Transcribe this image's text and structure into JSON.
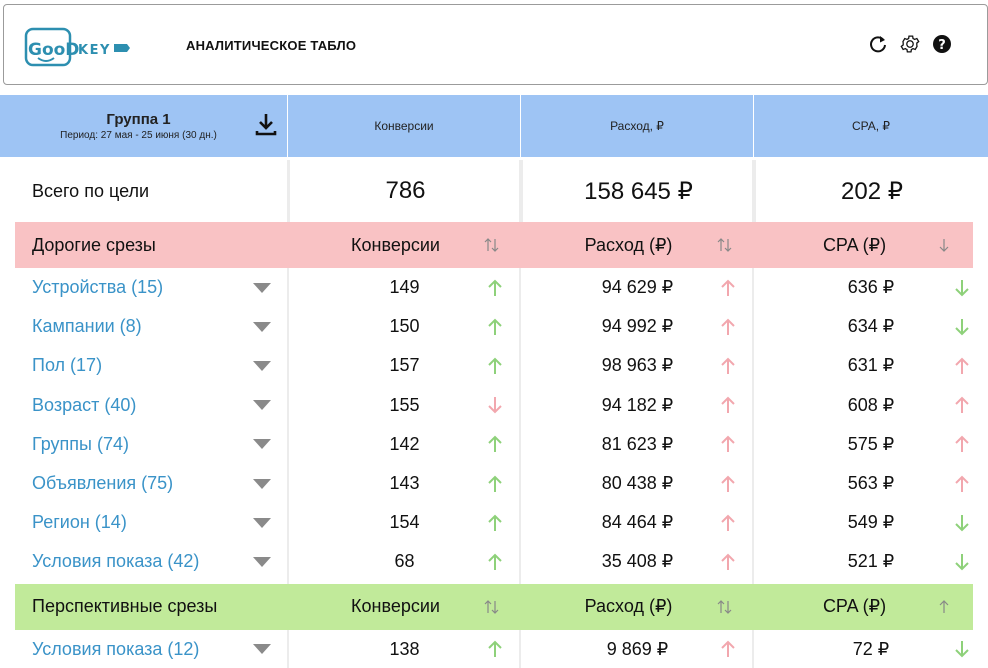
{
  "app": {
    "title": "АНАЛИТИЧЕСКОЕ ТАБЛО",
    "logo_text": "GooD KEY"
  },
  "icons": {
    "refresh": "refresh-icon",
    "settings": "gear-icon",
    "help": "help-icon",
    "download": "download-icon"
  },
  "header": {
    "group_name": "Группа 1",
    "group_period": "Период: 27 мая - 25 июня (30 дн.)",
    "col1": "Конверсии",
    "col2": "Расход, ₽",
    "col3": "CPA, ₽"
  },
  "total": {
    "label": "Всего по цели",
    "conversions": "786",
    "expense": "158 645 ₽",
    "cpa": "202 ₽"
  },
  "colors": {
    "header_blue": "#9ec4f4",
    "expensive_red": "#f9c2c4",
    "prospective_green": "#c1ea9a",
    "link_blue": "#3a93c8",
    "arrow_green": "#8ed17a",
    "arrow_red": "#f2a7ae"
  },
  "expensive": {
    "title": "Дорогие срезы",
    "col1": "Конверсии",
    "col2": "Расход (₽)",
    "col3": "CPA (₽)",
    "sort1": "sort-updown",
    "sort2": "sort-updown",
    "sort3": "sort-down",
    "rows": [
      {
        "label": "Устройства (15)",
        "conv": "149",
        "conv_dir": "up-green",
        "exp": "94 629 ₽",
        "exp_dir": "up-red",
        "cpa": "636 ₽",
        "cpa_dir": "down-green"
      },
      {
        "label": "Кампании (8)",
        "conv": "150",
        "conv_dir": "up-green",
        "exp": "94 992 ₽",
        "exp_dir": "up-red",
        "cpa": "634 ₽",
        "cpa_dir": "down-green"
      },
      {
        "label": "Пол (17)",
        "conv": "157",
        "conv_dir": "up-green",
        "exp": "98 963 ₽",
        "exp_dir": "up-red",
        "cpa": "631 ₽",
        "cpa_dir": "up-red"
      },
      {
        "label": "Возраст (40)",
        "conv": "155",
        "conv_dir": "down-red",
        "exp": "94 182 ₽",
        "exp_dir": "up-red",
        "cpa": "608 ₽",
        "cpa_dir": "up-red"
      },
      {
        "label": "Группы (74)",
        "conv": "142",
        "conv_dir": "up-green",
        "exp": "81 623 ₽",
        "exp_dir": "up-red",
        "cpa": "575 ₽",
        "cpa_dir": "up-red"
      },
      {
        "label": "Объявления (75)",
        "conv": "143",
        "conv_dir": "up-green",
        "exp": "80 438 ₽",
        "exp_dir": "up-red",
        "cpa": "563 ₽",
        "cpa_dir": "up-red"
      },
      {
        "label": "Регион (14)",
        "conv": "154",
        "conv_dir": "up-green",
        "exp": "84 464 ₽",
        "exp_dir": "up-red",
        "cpa": "549 ₽",
        "cpa_dir": "down-green"
      },
      {
        "label": "Условия показа (42)",
        "conv": "68",
        "conv_dir": "up-green",
        "exp": "35 408 ₽",
        "exp_dir": "up-red",
        "cpa": "521 ₽",
        "cpa_dir": "down-green"
      }
    ]
  },
  "prospective": {
    "title": "Перспективные срезы",
    "col1": "Конверсии",
    "col2": "Расход (₽)",
    "col3": "CPA (₽)",
    "sort1": "sort-updown",
    "sort2": "sort-updown",
    "sort3": "sort-up",
    "rows": [
      {
        "label": "Условия показа (12)",
        "conv": "138",
        "conv_dir": "up-green",
        "exp": "9 869 ₽",
        "exp_dir": "up-red",
        "cpa": "72 ₽",
        "cpa_dir": "down-green"
      }
    ]
  }
}
